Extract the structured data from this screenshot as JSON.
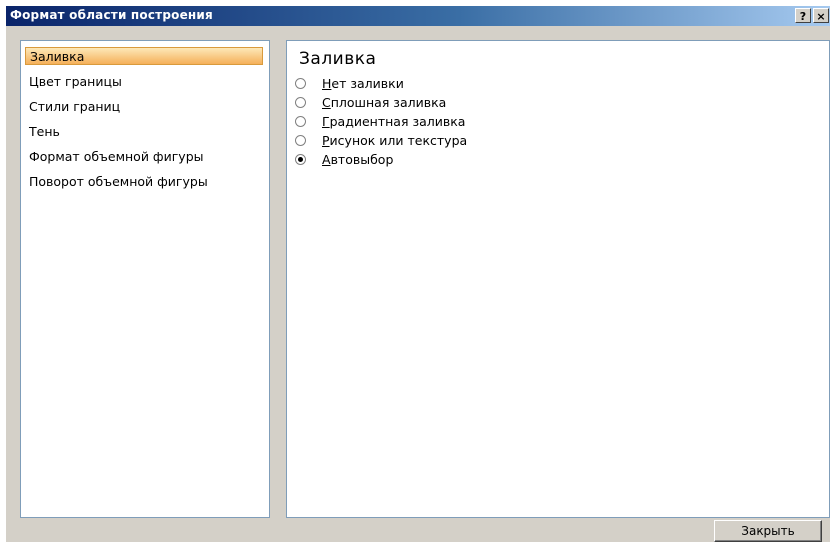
{
  "window": {
    "title": "Формат области построения",
    "help_label": "?",
    "close_label": "×"
  },
  "sidebar": {
    "items": [
      {
        "label": "Заливка",
        "selected": true
      },
      {
        "label": "Цвет границы",
        "selected": false
      },
      {
        "label": "Стили границ",
        "selected": false
      },
      {
        "label": "Тень",
        "selected": false
      },
      {
        "label": "Формат объемной фигуры",
        "selected": false
      },
      {
        "label": "Поворот объемной фигуры",
        "selected": false
      }
    ]
  },
  "main": {
    "title": "Заливка",
    "options": [
      {
        "mnemonic": "Н",
        "rest": "ет заливки",
        "checked": false
      },
      {
        "mnemonic": "С",
        "rest": "плошная заливка",
        "checked": false
      },
      {
        "mnemonic": "Г",
        "rest": "радиентная заливка",
        "checked": false
      },
      {
        "mnemonic": "Р",
        "rest": "исунок или текстура",
        "checked": false
      },
      {
        "mnemonic": "А",
        "rest": "втовыбор",
        "checked": true
      }
    ]
  },
  "footer": {
    "close_button_label": "Закрыть"
  },
  "colors": {
    "titlebar_start": "#0a246a",
    "titlebar_end": "#a6caf0",
    "dialog_background": "#d4d0c8",
    "selected_item_start": "#fde8b8",
    "selected_item_end": "#f5b05a"
  }
}
